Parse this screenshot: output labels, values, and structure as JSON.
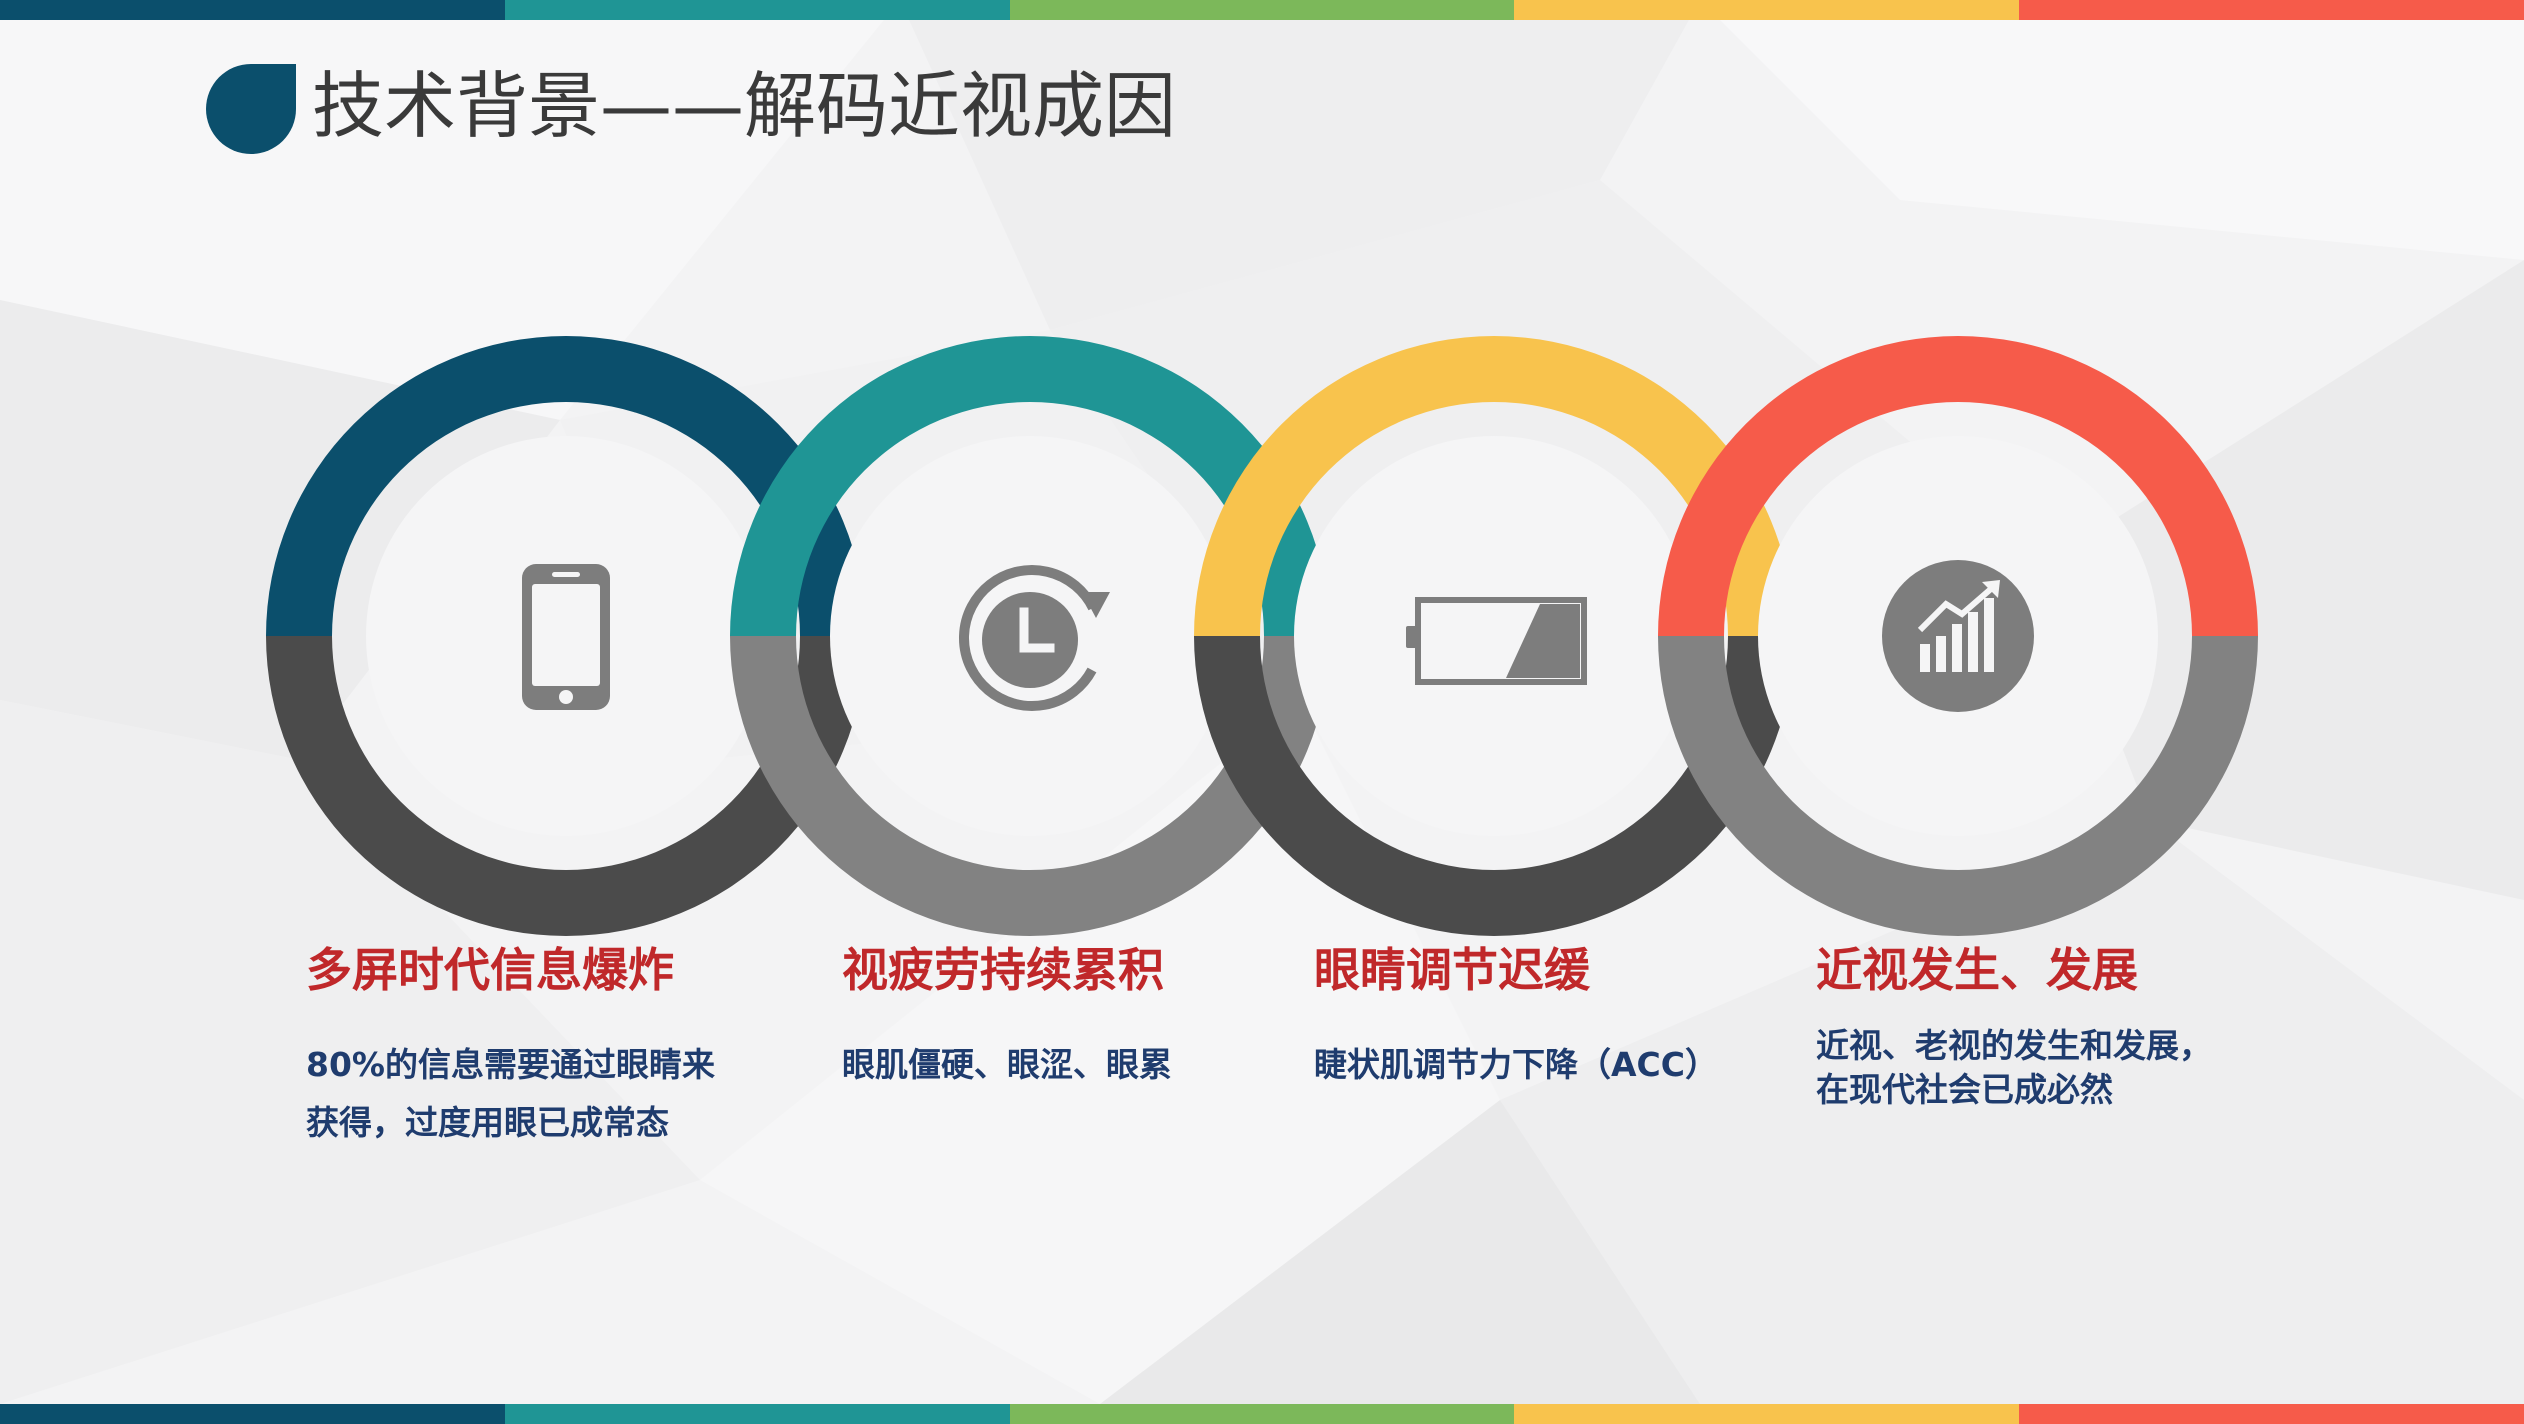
{
  "slide": {
    "title": "技术背景——解码近视成因",
    "stripe_colors": [
      "#0b4f6c",
      "#1f9595",
      "#7cb85a",
      "#f8c34d",
      "#f65b4a"
    ]
  },
  "rings": [
    {
      "top_color": "#0b4f6c",
      "bottom_color": "#4b4b4b",
      "icon": "smartphone-icon"
    },
    {
      "top_color": "#1f9595",
      "bottom_color": "#828282",
      "icon": "clock-refresh-icon"
    },
    {
      "top_color": "#f8c34d",
      "bottom_color": "#4b4b4b",
      "icon": "low-battery-icon"
    },
    {
      "top_color": "#f65b4a",
      "bottom_color": "#828282",
      "icon": "growth-chart-icon"
    }
  ],
  "columns": [
    {
      "heading": "多屏时代信息爆炸",
      "lines": [
        "80%的信息需要通过眼睛来",
        "获得，过度用眼已成常态"
      ]
    },
    {
      "heading": "视疲劳持续累积",
      "lines": [
        "眼肌僵硬、眼涩、眼累"
      ]
    },
    {
      "heading": "眼睛调节迟缓",
      "lines": [
        "睫状肌调节力下降（ACC）"
      ]
    },
    {
      "heading": "近视发生、发展",
      "lines": [
        "近视、老视的发生和发展，",
        "在现代社会已成必然"
      ]
    }
  ]
}
